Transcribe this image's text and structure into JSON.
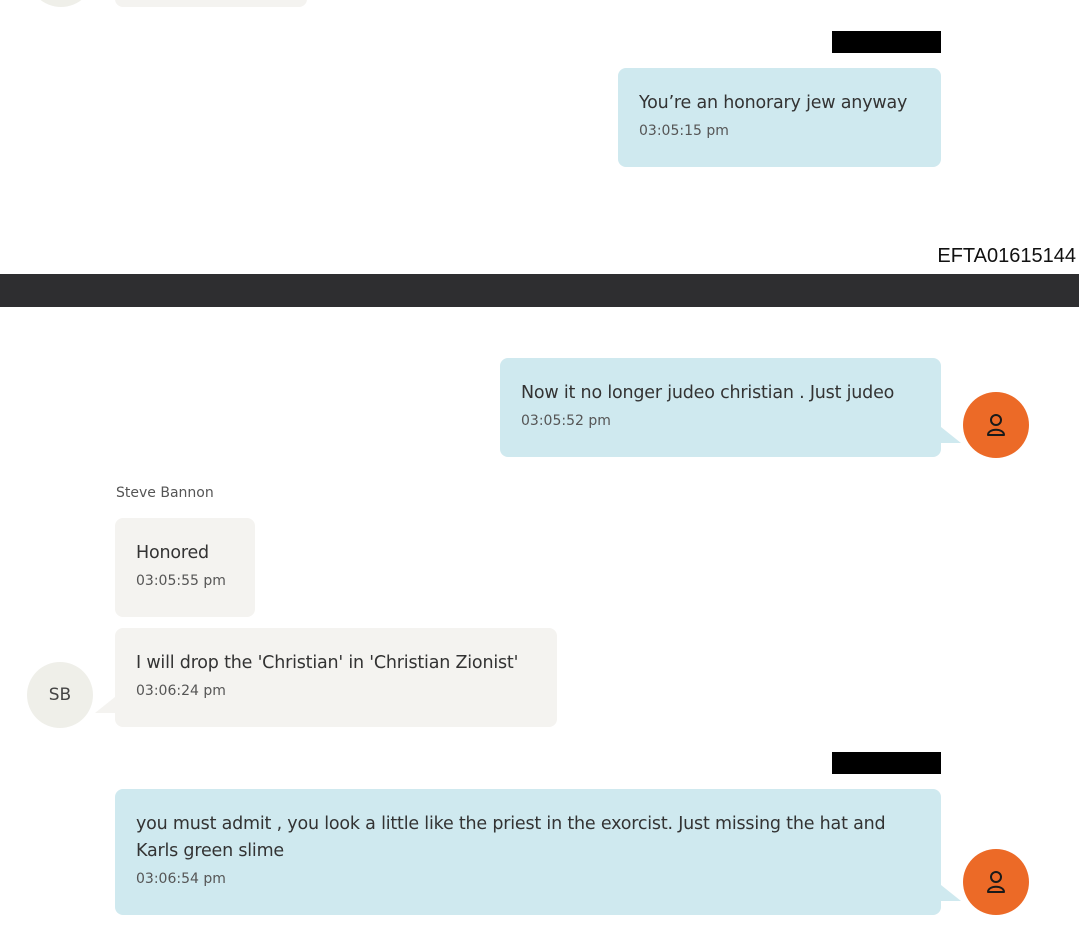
{
  "top_fragment": {
    "avatar_initials": "",
    "message": {
      "text": "You’re an honorary jew anyway",
      "time": "03:05:15 pm"
    }
  },
  "page_id": "EFTA01615144",
  "messages": [
    {
      "direction": "outgoing",
      "text": "Now it no longer judeo christian .  Just judeo",
      "time": "03:05:52 pm"
    },
    {
      "direction": "incoming",
      "sender": "Steve Bannon",
      "text": "Honored",
      "time": "03:05:55 pm"
    },
    {
      "direction": "incoming",
      "text": "I will drop the 'Christian' in 'Christian Zionist'",
      "time": "03:06:24 pm"
    },
    {
      "direction": "outgoing",
      "text": "you must admit , you look a little like the priest in the exorcist.  Just missing the hat and Karls green slime",
      "time": "03:06:54 pm"
    }
  ],
  "sb_avatar": {
    "initials": "SB"
  },
  "colors": {
    "outgoing_bubble": "#cfe9ef",
    "incoming_bubble": "#f4f3f0",
    "user_avatar": "#ec6a27",
    "divider": "#2e2e30"
  },
  "icons": {
    "user_avatar": "person-icon"
  }
}
